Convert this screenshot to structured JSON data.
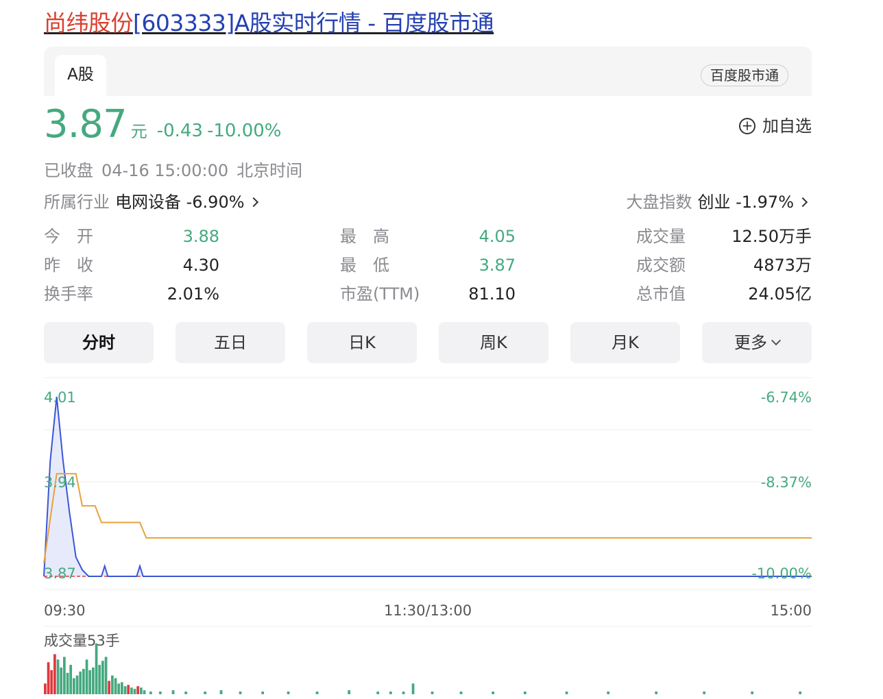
{
  "page_title": {
    "stock_name": "尚纬股份",
    "rest": "[603333]A股实时行情 - 百度股市通"
  },
  "tabs": {
    "active": "A股",
    "brand": "百度股市通"
  },
  "quote": {
    "price": "3.87",
    "unit": "元",
    "change": "-0.43",
    "change_pct": "-10.00%"
  },
  "watch_button": {
    "icon": "plus-circle-icon",
    "label": "加自选"
  },
  "status": {
    "state": "已收盘",
    "datetime": "04-16 15:00:00",
    "timezone": "北京时间"
  },
  "industry": {
    "label": "所属行业",
    "value": "电网设备 -6.90%"
  },
  "market_index": {
    "label": "大盘指数",
    "value": "创业 -1.97%"
  },
  "stats": [
    [
      {
        "k": "今　开",
        "v": "3.88",
        "color": "#45a97f"
      },
      {
        "k": "昨　收",
        "v": "4.30",
        "color": "#222222"
      },
      {
        "k": "换手率",
        "v": "2.01%",
        "color": "#222222"
      }
    ],
    [
      {
        "k": "最　高",
        "v": "4.05",
        "color": "#45a97f"
      },
      {
        "k": "最　低",
        "v": "3.87",
        "color": "#45a97f"
      },
      {
        "k": "市盈(TTM)",
        "v": "81.10",
        "color": "#222222"
      }
    ],
    [
      {
        "k": "成交量",
        "v": "12.50万手",
        "color": "#222222"
      },
      {
        "k": "成交额",
        "v": "4873万",
        "color": "#222222"
      },
      {
        "k": "总市值",
        "v": "24.05亿",
        "color": "#222222"
      }
    ]
  ],
  "period_tabs": [
    {
      "label": "分时",
      "active": true
    },
    {
      "label": "五日",
      "active": false
    },
    {
      "label": "日K",
      "active": false
    },
    {
      "label": "周K",
      "active": false
    },
    {
      "label": "月K",
      "active": false
    },
    {
      "label": "更多",
      "active": false,
      "dropdown": true
    }
  ],
  "colors": {
    "down": "#45a97f",
    "up": "#e0393e",
    "price_line": "#3a55d6",
    "avg_line": "#e6a23c",
    "ref_line": "#e0393e"
  },
  "chart_data": {
    "type": "line",
    "y_left_labels": [
      "4.01",
      "3.94",
      "3.87"
    ],
    "y_right_labels": [
      "-6.74%",
      "-8.37%",
      "-10.00%"
    ],
    "x_labels": [
      "09:30",
      "11:30/13:00",
      "15:00"
    ],
    "ylim": [
      3.87,
      4.01
    ],
    "total_minutes": 240,
    "series": [
      {
        "role": "price",
        "points": [
          [
            0,
            3.87
          ],
          [
            2,
            3.96
          ],
          [
            4,
            4.01
          ],
          [
            6,
            3.96
          ],
          [
            8,
            3.92
          ],
          [
            10,
            3.885
          ],
          [
            12,
            3.875
          ],
          [
            14,
            3.87
          ],
          [
            18,
            3.87
          ],
          [
            19,
            3.878
          ],
          [
            20,
            3.87
          ],
          [
            29,
            3.87
          ],
          [
            30,
            3.878
          ],
          [
            31,
            3.87
          ],
          [
            240,
            3.87
          ]
        ]
      },
      {
        "role": "average",
        "points": [
          [
            0,
            3.88
          ],
          [
            4,
            3.95
          ],
          [
            10,
            3.95
          ],
          [
            12,
            3.925
          ],
          [
            16,
            3.925
          ],
          [
            18,
            3.912
          ],
          [
            30,
            3.912
          ],
          [
            32,
            3.9
          ],
          [
            240,
            3.9
          ]
        ]
      }
    ],
    "volume": {
      "label": "成交量53手",
      "bars": [
        [
          0,
          8,
          "up"
        ],
        [
          1,
          24,
          "up"
        ],
        [
          2,
          18,
          "up"
        ],
        [
          3,
          30,
          "up"
        ],
        [
          4,
          26,
          "down"
        ],
        [
          5,
          20,
          "down"
        ],
        [
          6,
          28,
          "down"
        ],
        [
          7,
          16,
          "down"
        ],
        [
          8,
          22,
          "down"
        ],
        [
          9,
          12,
          "down"
        ],
        [
          10,
          14,
          "down"
        ],
        [
          11,
          17,
          "down"
        ],
        [
          12,
          19,
          "down"
        ],
        [
          13,
          26,
          "down"
        ],
        [
          14,
          18,
          "down"
        ],
        [
          15,
          20,
          "down"
        ],
        [
          16,
          38,
          "down"
        ],
        [
          17,
          22,
          "down"
        ],
        [
          18,
          25,
          "down"
        ],
        [
          19,
          28,
          "down"
        ],
        [
          20,
          10,
          "up"
        ],
        [
          21,
          14,
          "down"
        ],
        [
          22,
          12,
          "down"
        ],
        [
          23,
          8,
          "down"
        ],
        [
          24,
          9,
          "down"
        ],
        [
          25,
          6,
          "down"
        ],
        [
          26,
          7,
          "up"
        ],
        [
          27,
          5,
          "down"
        ],
        [
          28,
          4,
          "down"
        ],
        [
          29,
          6,
          "up"
        ],
        [
          30,
          5,
          "down"
        ],
        [
          31,
          3,
          "down"
        ],
        [
          33,
          2,
          "down"
        ],
        [
          36,
          2,
          "down"
        ],
        [
          40,
          3,
          "down"
        ],
        [
          44,
          2,
          "down"
        ],
        [
          50,
          2,
          "down"
        ],
        [
          55,
          3,
          "down"
        ],
        [
          61,
          2,
          "down"
        ],
        [
          68,
          2,
          "down"
        ],
        [
          76,
          2,
          "down"
        ],
        [
          85,
          2,
          "down"
        ],
        [
          95,
          3,
          "down"
        ],
        [
          104,
          2,
          "down"
        ],
        [
          108,
          2,
          "down"
        ],
        [
          112,
          2,
          "down"
        ],
        [
          115,
          8,
          "down"
        ],
        [
          121,
          2,
          "down"
        ],
        [
          130,
          2,
          "down"
        ],
        [
          140,
          2,
          "down"
        ],
        [
          150,
          2,
          "down"
        ],
        [
          163,
          2,
          "down"
        ],
        [
          176,
          2,
          "down"
        ],
        [
          191,
          2,
          "down"
        ],
        [
          206,
          2,
          "down"
        ],
        [
          221,
          2,
          "down"
        ],
        [
          236,
          2,
          "down"
        ]
      ]
    }
  }
}
